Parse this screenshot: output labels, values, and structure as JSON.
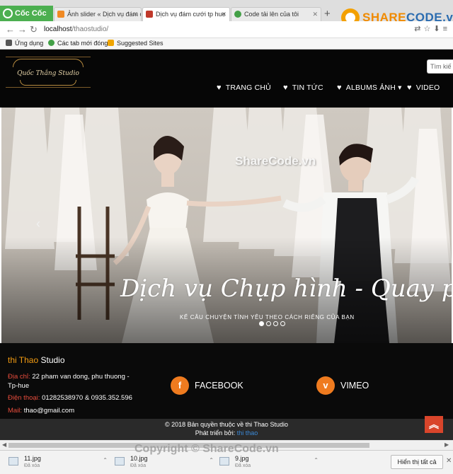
{
  "browser": {
    "brand": "Cốc Cốc",
    "tabs": [
      {
        "label": "Ảnh slider « Dịch vụ đám c",
        "favicon_color": "#f08a24"
      },
      {
        "label": "Dịch vụ đám cưới tp hue",
        "favicon_color": "#c0392b"
      },
      {
        "label": "Code tải lên của tôi",
        "favicon_color": "#43a047"
      }
    ],
    "new_tab": "+",
    "url_host": "localhost",
    "url_path": "/thaostudio/",
    "bookmarks": [
      {
        "label": "Ứng dụng",
        "icon_color": "#555555"
      },
      {
        "label": "Các tab mới đóng",
        "icon_color": "#43a047"
      },
      {
        "label": "Suggested Sites",
        "icon_color": "#f0a500"
      }
    ],
    "sharecode_logo": {
      "share": "SHARE",
      "code": "CODE.vn"
    }
  },
  "header": {
    "logo_text": "Quốc Thắng Studio",
    "search_placeholder": "Tìm kiế",
    "menu": [
      {
        "label": "TRANG CHỦ",
        "icon": "heart-icon"
      },
      {
        "label": "TIN TỨC",
        "icon": "heart-icon"
      },
      {
        "label": "ALBUMS ẢNH",
        "icon": "heart-icon",
        "dropdown": "▾"
      },
      {
        "label": "VIDEO",
        "icon": "heart-icon"
      }
    ]
  },
  "slider": {
    "title": "Dịch vụ Chụp hình - Quay phim",
    "subtitle": "KỂ CÂU CHUYỆN TÌNH YÊU THEO CÁCH RIÊNG CỦA BẠN",
    "watermark": "ShareCode.vn",
    "prev_arrow": "‹",
    "slide_count": 4,
    "active_slide": 1
  },
  "footer": {
    "studio_highlight": "thi Thao",
    "studio_rest": " Studio",
    "address_label": "Địa chỉ: ",
    "address_value": "22 pham van dong, phu thuong - Tp-hue",
    "phone_label": "Điện thoại: ",
    "phone_value": "01282538970 & 0935.352.596",
    "mail_label": "Mail: ",
    "mail_value": "thao@gmail.com",
    "social": [
      {
        "label": "FACEBOOK",
        "glyph": "f",
        "icon": "facebook-icon"
      },
      {
        "label": "VIMEO",
        "glyph": "v",
        "icon": "vimeo-icon"
      }
    ],
    "copyright": "© 2018 Bản quyền thuộc về thi Thao Studio",
    "developer_label": "Phát triển bởi: ",
    "developer_name": "thi thao",
    "back_to_top": "︽"
  },
  "downloads": {
    "items": [
      {
        "name": "11.jpg",
        "status": "Đã xóa"
      },
      {
        "name": "10.jpg",
        "status": "Đã xóa"
      },
      {
        "name": "9.jpg",
        "status": "Đã xóa"
      }
    ],
    "show_all": "Hiển thị tất cả",
    "close": "✕",
    "watermark": "Copyright © ShareCode.vn"
  }
}
